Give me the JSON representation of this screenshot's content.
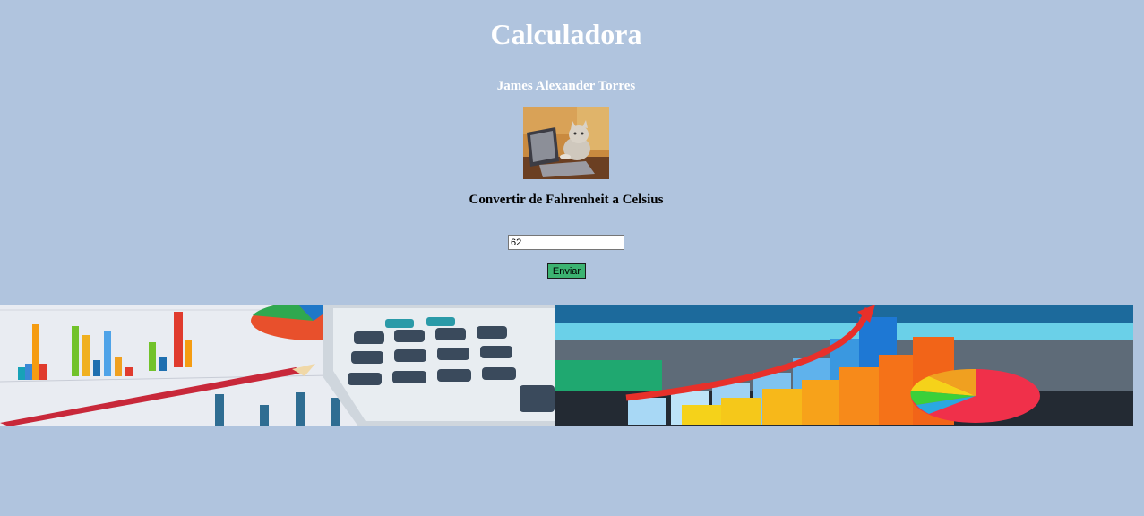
{
  "page": {
    "title": "Calculadora",
    "author": "James Alexander Torres",
    "subtitle": "Convertir de Fahrenheit a Celsius"
  },
  "form": {
    "fahrenheit_value": "62",
    "submit_label": "Enviar"
  },
  "images": {
    "avatar": "cat-at-laptop-image",
    "banner_left": "calculator-and-charts-image",
    "banner_right": "bar-chart-growth-image"
  },
  "colors": {
    "background": "#b0c4de",
    "button": "#3cb371"
  }
}
